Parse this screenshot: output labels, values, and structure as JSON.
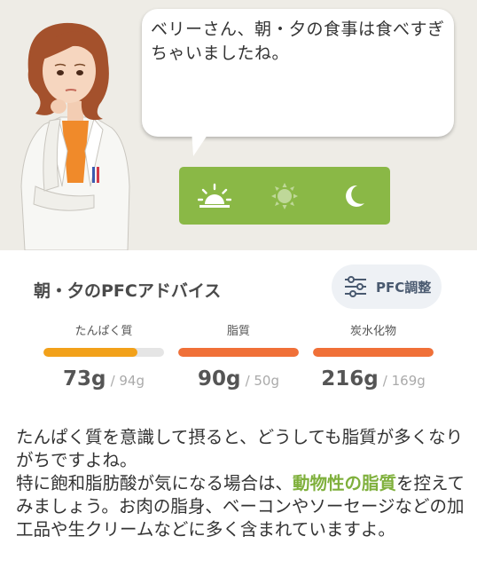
{
  "bubble": {
    "message": "ベリーさん、朝・夕の食事は食べすぎちゃいましたね。"
  },
  "meals": [
    {
      "name": "morning",
      "icon": "sunrise-icon",
      "selected": true
    },
    {
      "name": "noon",
      "icon": "sun-icon",
      "selected": false
    },
    {
      "name": "evening",
      "icon": "moon-icon",
      "selected": true
    }
  ],
  "advice_card": {
    "title": "朝・夕のPFCアドバイス",
    "adjust_button": "PFC調整",
    "nutrients": [
      {
        "label": "たんぱく質",
        "value": "73",
        "unit": "g",
        "target": "/ 94g",
        "progress": 0.78,
        "color": "#f2a11a"
      },
      {
        "label": "脂質",
        "value": "90",
        "unit": "g",
        "target": "/ 50g",
        "progress": 1.0,
        "color": "#f07038"
      },
      {
        "label": "炭水化物",
        "value": "216",
        "unit": "g",
        "target": "/ 169g",
        "progress": 1.0,
        "color": "#f07038"
      }
    ]
  },
  "advice": {
    "line1": "たんぱく質を意識して摂ると、どうしても脂質が多くなりがちですよね。",
    "line2_pre": "特に飽和脂肪酸が気になる場合は、",
    "line2_highlight": "動物性の脂質",
    "line2_post": "を控えてみましょう。お肉の脂身、ベーコンやソーセージなどの加工品や生クリームなどに多く含まれていますよ。"
  },
  "colors": {
    "accent_green": "#8ab846",
    "highlight": "#7fb03c",
    "background": "#eeece6"
  }
}
